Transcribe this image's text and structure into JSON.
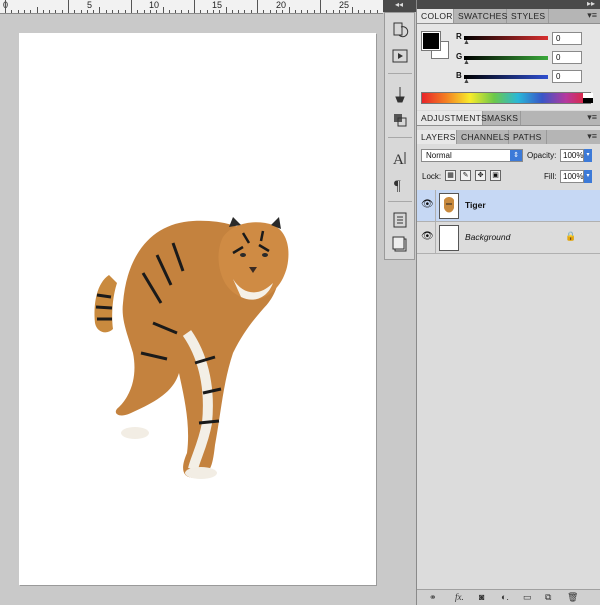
{
  "ruler": {
    "labels": [
      "0",
      "5",
      "10",
      "15",
      "20",
      "25"
    ]
  },
  "color_panel": {
    "tabs": [
      "COLOR",
      "SWATCHES",
      "STYLES"
    ],
    "channels": [
      {
        "label": "R",
        "value": "0",
        "color": "#d83030"
      },
      {
        "label": "G",
        "value": "0",
        "color": "#3aa83a"
      },
      {
        "label": "B",
        "value": "0",
        "color": "#2f4fd0"
      }
    ]
  },
  "adjustments_panel": {
    "tabs": [
      "ADJUSTMENTS",
      "MASKS"
    ]
  },
  "layers_panel": {
    "tabs": [
      "LAYERS",
      "CHANNELS",
      "PATHS"
    ],
    "blend_mode": "Normal",
    "opacity_label": "Opacity:",
    "opacity_value": "100%",
    "lock_label": "Lock:",
    "fill_label": "Fill:",
    "fill_value": "100%",
    "layers": [
      {
        "name": "Tiger",
        "selected": true
      },
      {
        "name": "Background",
        "selected": false
      }
    ]
  },
  "colors": {
    "selection": "#c6d8f4",
    "accent": "#3c7ad8"
  }
}
